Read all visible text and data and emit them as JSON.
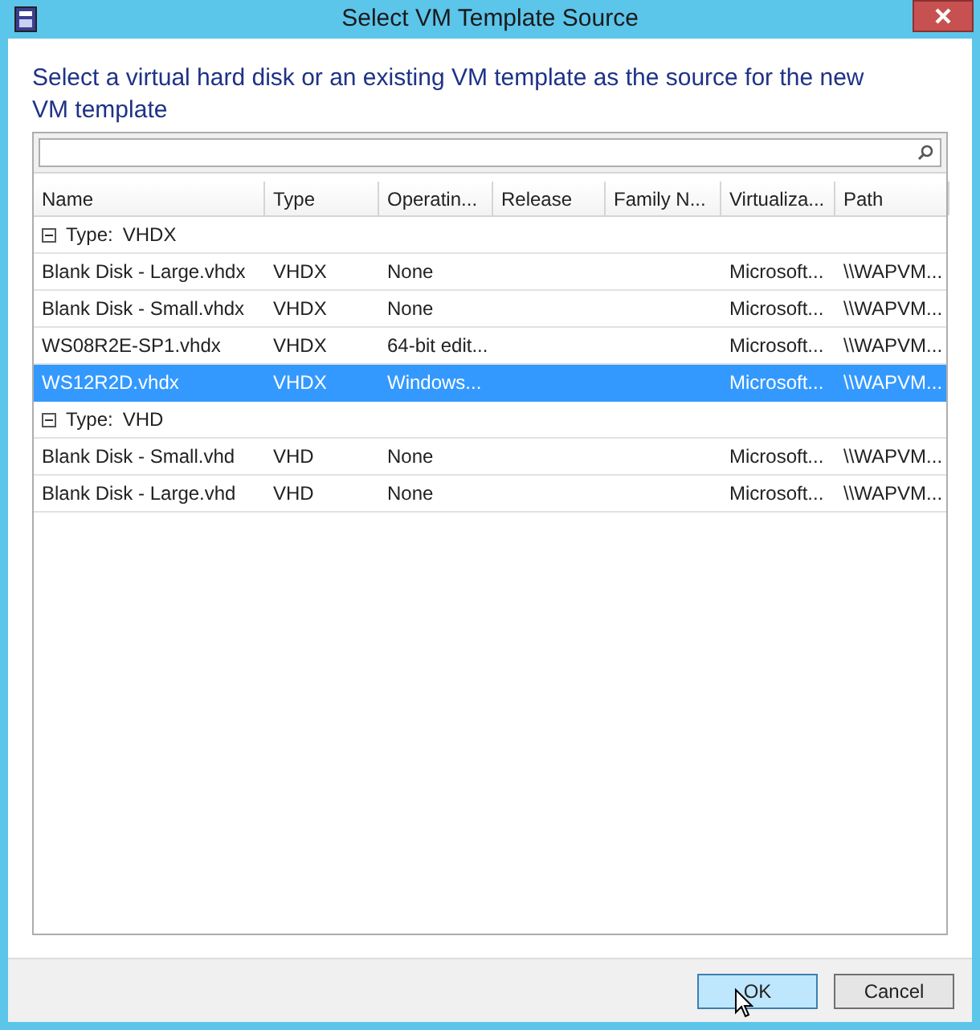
{
  "window": {
    "title": "Select VM Template Source"
  },
  "instruction": "Select a virtual hard disk or an existing VM template as the source for the new VM template",
  "table": {
    "columns": [
      "Name",
      "Type",
      "Operatin...",
      "Release",
      "Family N...",
      "Virtualiza...",
      "Path"
    ],
    "groups": [
      {
        "label": "Type:",
        "value": "VHDX",
        "expanded": true,
        "rows": [
          {
            "cells": [
              "Blank Disk - Large.vhdx",
              "VHDX",
              "None",
              "",
              "",
              "Microsoft...",
              "\\\\WAPVM..."
            ],
            "selected": false
          },
          {
            "cells": [
              "Blank Disk - Small.vhdx",
              "VHDX",
              "None",
              "",
              "",
              "Microsoft...",
              "\\\\WAPVM..."
            ],
            "selected": false
          },
          {
            "cells": [
              "WS08R2E-SP1.vhdx",
              "VHDX",
              "64-bit edit...",
              "",
              "",
              "Microsoft...",
              "\\\\WAPVM..."
            ],
            "selected": false
          },
          {
            "cells": [
              "WS12R2D.vhdx",
              "VHDX",
              "Windows...",
              "",
              "",
              "Microsoft...",
              "\\\\WAPVM..."
            ],
            "selected": true
          }
        ]
      },
      {
        "label": "Type:",
        "value": "VHD",
        "expanded": true,
        "rows": [
          {
            "cells": [
              "Blank Disk - Small.vhd",
              "VHD",
              "None",
              "",
              "",
              "Microsoft...",
              "\\\\WAPVM..."
            ],
            "selected": false
          },
          {
            "cells": [
              "Blank Disk - Large.vhd",
              "VHD",
              "None",
              "",
              "",
              "Microsoft...",
              "\\\\WAPVM..."
            ],
            "selected": false
          }
        ]
      }
    ]
  },
  "buttons": [
    {
      "label": "OK",
      "kind": "primary"
    },
    {
      "label": "Cancel",
      "kind": "normal"
    }
  ]
}
